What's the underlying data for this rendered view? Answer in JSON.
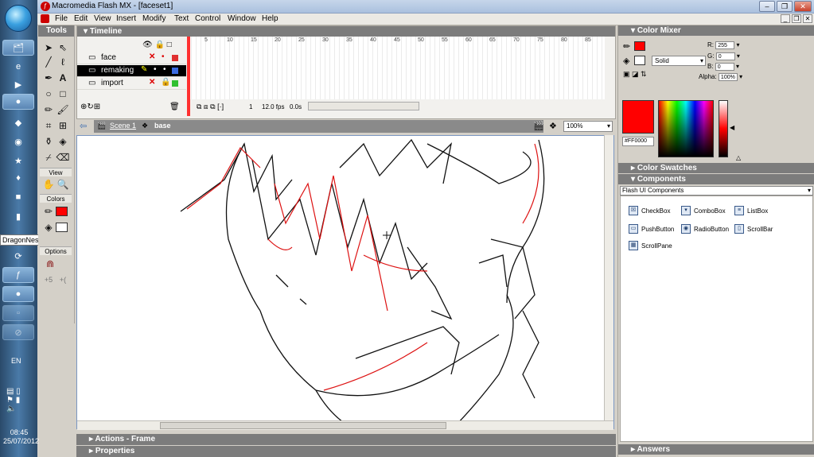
{
  "window": {
    "title": "Macromedia Flash MX - [faceset1]"
  },
  "menu": [
    "File",
    "Edit",
    "View",
    "Insert",
    "Modify",
    "Text",
    "Control",
    "Window",
    "Help"
  ],
  "tools": {
    "header": "Tools",
    "view_label": "View",
    "colors_label": "Colors",
    "options_label": "Options"
  },
  "timeline": {
    "header": "Timeline",
    "layers": [
      {
        "name": "face",
        "selected": false
      },
      {
        "name": "remaking",
        "selected": true
      },
      {
        "name": "import",
        "selected": false
      }
    ],
    "ruler": [
      "5",
      "10",
      "15",
      "20",
      "25",
      "30",
      "35",
      "40",
      "45",
      "50",
      "55",
      "60",
      "65",
      "70",
      "75",
      "80",
      "85"
    ],
    "current_frame": "1",
    "fps": "12.0 fps",
    "time": "0.0s"
  },
  "scene": {
    "scene_label": "Scene 1",
    "symbol_label": "base",
    "zoom": "100%"
  },
  "bottom_panels": {
    "actions": "Actions - Frame",
    "properties": "Properties"
  },
  "color_mixer": {
    "header": "Color Mixer",
    "r_label": "R:",
    "r": "255",
    "g_label": "G:",
    "g": "0",
    "b_label": "B:",
    "b": "0",
    "alpha_label": "Alpha:",
    "alpha": "100%",
    "fill_type": "Solid",
    "hex": "#FF0000",
    "swatch_color": "#ff0000"
  },
  "panels": {
    "swatches": "Color Swatches",
    "components": "Components",
    "components_select": "Flash UI Components",
    "answers": "Answers"
  },
  "components": [
    "CheckBox",
    "ComboBox",
    "ListBox",
    "PushButton",
    "RadioButton",
    "ScrollBar",
    "ScrollPane"
  ],
  "taskbar": {
    "tooltip": "DragonNest Launcher",
    "lang": "EN",
    "time": "08:45",
    "date": "25/07/2012"
  }
}
